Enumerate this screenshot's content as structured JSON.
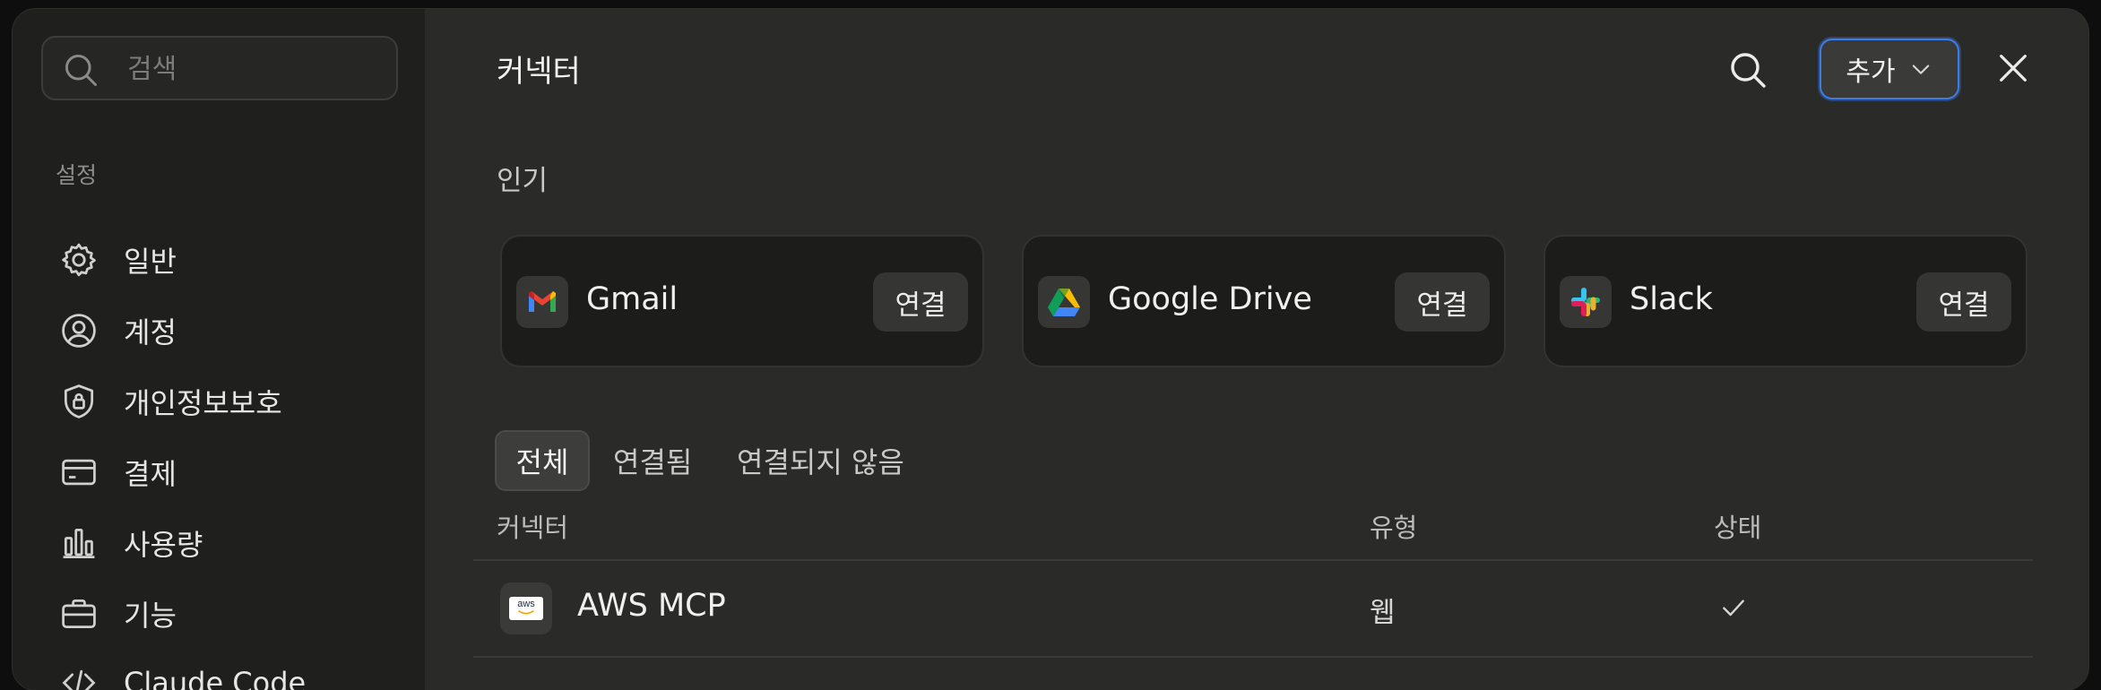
{
  "sidebar": {
    "search_placeholder": "검색",
    "section_label": "설정",
    "items": [
      {
        "label": "일반",
        "icon": "gear-icon"
      },
      {
        "label": "계정",
        "icon": "user-circle-icon"
      },
      {
        "label": "개인정보보호",
        "icon": "shield-lock-icon"
      },
      {
        "label": "결제",
        "icon": "credit-card-icon"
      },
      {
        "label": "사용량",
        "icon": "bar-chart-icon"
      },
      {
        "label": "기능",
        "icon": "briefcase-icon"
      },
      {
        "label": "Claude Code",
        "icon": "code-icon"
      }
    ]
  },
  "header": {
    "title": "커넥터",
    "add_label": "추가",
    "search_icon": "search-icon",
    "close_icon": "close-icon"
  },
  "popular": {
    "label": "인기",
    "cards": [
      {
        "name": "Gmail",
        "connect_label": "연결",
        "icon": "gmail-icon"
      },
      {
        "name": "Google Drive",
        "connect_label": "연결",
        "icon": "google-drive-icon"
      },
      {
        "name": "Slack",
        "connect_label": "연결",
        "icon": "slack-icon"
      }
    ]
  },
  "tabs": [
    {
      "label": "전체",
      "active": true
    },
    {
      "label": "연결됨",
      "active": false
    },
    {
      "label": "연결되지 않음",
      "active": false
    }
  ],
  "table": {
    "columns": [
      "커넥터",
      "유형",
      "상태"
    ],
    "rows": [
      {
        "name": "AWS MCP",
        "logo_text": "aws",
        "type": "웹",
        "status": "check-icon"
      }
    ]
  },
  "colors": {
    "accent": "#3d7de8",
    "dialog_bg": "#2a2a29",
    "sidebar_bg": "#1f1f1e"
  }
}
